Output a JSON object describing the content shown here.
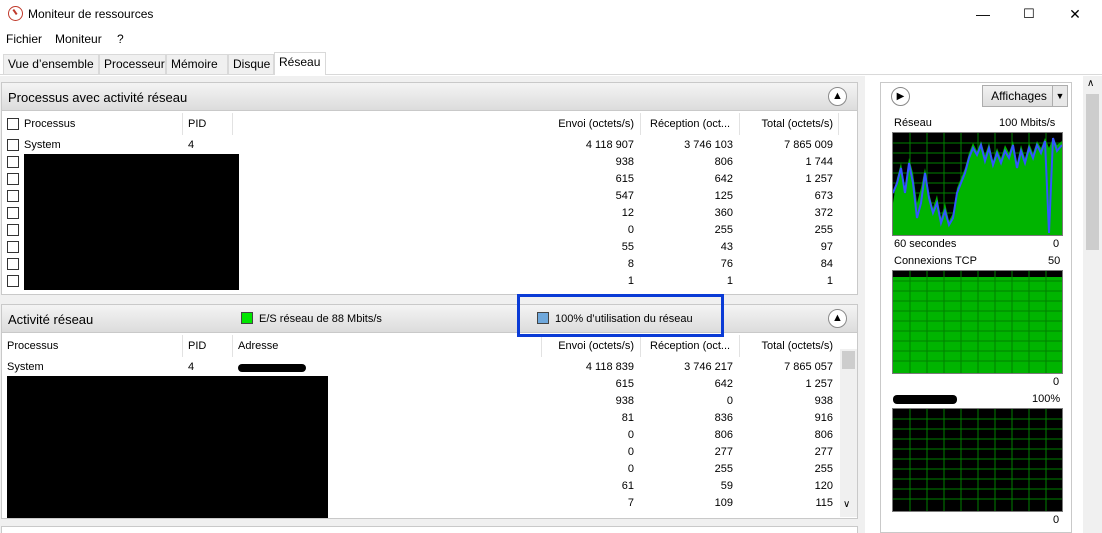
{
  "window": {
    "title": "Moniteur de ressources",
    "minimize": "—",
    "maximize": "☐",
    "close": "✕"
  },
  "menu": [
    "Fichier",
    "Moniteur",
    "?"
  ],
  "tabs": [
    "Vue d’ensemble",
    "Processeur",
    "Mémoire",
    "Disque",
    "Réseau"
  ],
  "processes_panel": {
    "title": "Processus avec activité réseau",
    "columns": {
      "process": "Processus",
      "pid": "PID",
      "send": "Envoi (octets/s)",
      "receive": "Réception (oct...",
      "total": "Total (octets/s)"
    },
    "rows": [
      {
        "name": "System",
        "pid": "4",
        "send": "4 118 907",
        "receive": "3 746 103",
        "total": "7 865 009"
      },
      {
        "name": "",
        "pid": "",
        "send": "938",
        "receive": "806",
        "total": "1 744"
      },
      {
        "name": "",
        "pid": "",
        "send": "615",
        "receive": "642",
        "total": "1 257"
      },
      {
        "name": "",
        "pid": "",
        "send": "547",
        "receive": "125",
        "total": "673"
      },
      {
        "name": "",
        "pid": "",
        "send": "12",
        "receive": "360",
        "total": "372"
      },
      {
        "name": "",
        "pid": "",
        "send": "0",
        "receive": "255",
        "total": "255"
      },
      {
        "name": "",
        "pid": "",
        "send": "55",
        "receive": "43",
        "total": "97"
      },
      {
        "name": "",
        "pid": "",
        "send": "8",
        "receive": "76",
        "total": "84"
      },
      {
        "name": "",
        "pid": "",
        "send": "1",
        "receive": "1",
        "total": "1"
      }
    ]
  },
  "activity_panel": {
    "title": "Activité réseau",
    "io_label": "E/S réseau de 88 Mbits/s",
    "io_color": "#00e600",
    "util_label": "100% d’utilisation du réseau",
    "util_color": "#6fa8dc",
    "columns": {
      "process": "Processus",
      "pid": "PID",
      "address": "Adresse",
      "send": "Envoi (octets/s)",
      "receive": "Réception (oct...",
      "total": "Total (octets/s)"
    },
    "rows": [
      {
        "name": "System",
        "pid": "4",
        "send": "4 118 839",
        "receive": "3 746 217",
        "total": "7 865 057"
      },
      {
        "name": "",
        "pid": "",
        "send": "615",
        "receive": "642",
        "total": "1 257"
      },
      {
        "name": "",
        "pid": "",
        "send": "938",
        "receive": "0",
        "total": "938"
      },
      {
        "name": "",
        "pid": "",
        "send": "81",
        "receive": "836",
        "total": "916"
      },
      {
        "name": "",
        "pid": "",
        "send": "0",
        "receive": "806",
        "total": "806"
      },
      {
        "name": "",
        "pid": "",
        "send": "0",
        "receive": "277",
        "total": "277"
      },
      {
        "name": "",
        "pid": "",
        "send": "0",
        "receive": "255",
        "total": "255"
      },
      {
        "name": "",
        "pid": "",
        "send": "61",
        "receive": "59",
        "total": "120"
      },
      {
        "name": "",
        "pid": "",
        "send": "7",
        "receive": "109",
        "total": "115"
      }
    ]
  },
  "right_panel": {
    "view_button": "Affichages",
    "network_graph": {
      "label": "Réseau",
      "max": "100 Mbits/s",
      "time": "60 secondes",
      "min": "0"
    },
    "tcp_graph": {
      "label": "Connexions TCP",
      "max": "50",
      "min": "0"
    },
    "adapter_graph": {
      "max": "100%",
      "min": "0"
    }
  },
  "colors": {
    "graph_green": "#00b400",
    "graph_blue": "#3355ff",
    "highlight": "#0a3bd6"
  },
  "icons": [
    "app-icon",
    "collapse-icon",
    "expand-icon",
    "dropdown-icon",
    "checkbox-icon"
  ]
}
